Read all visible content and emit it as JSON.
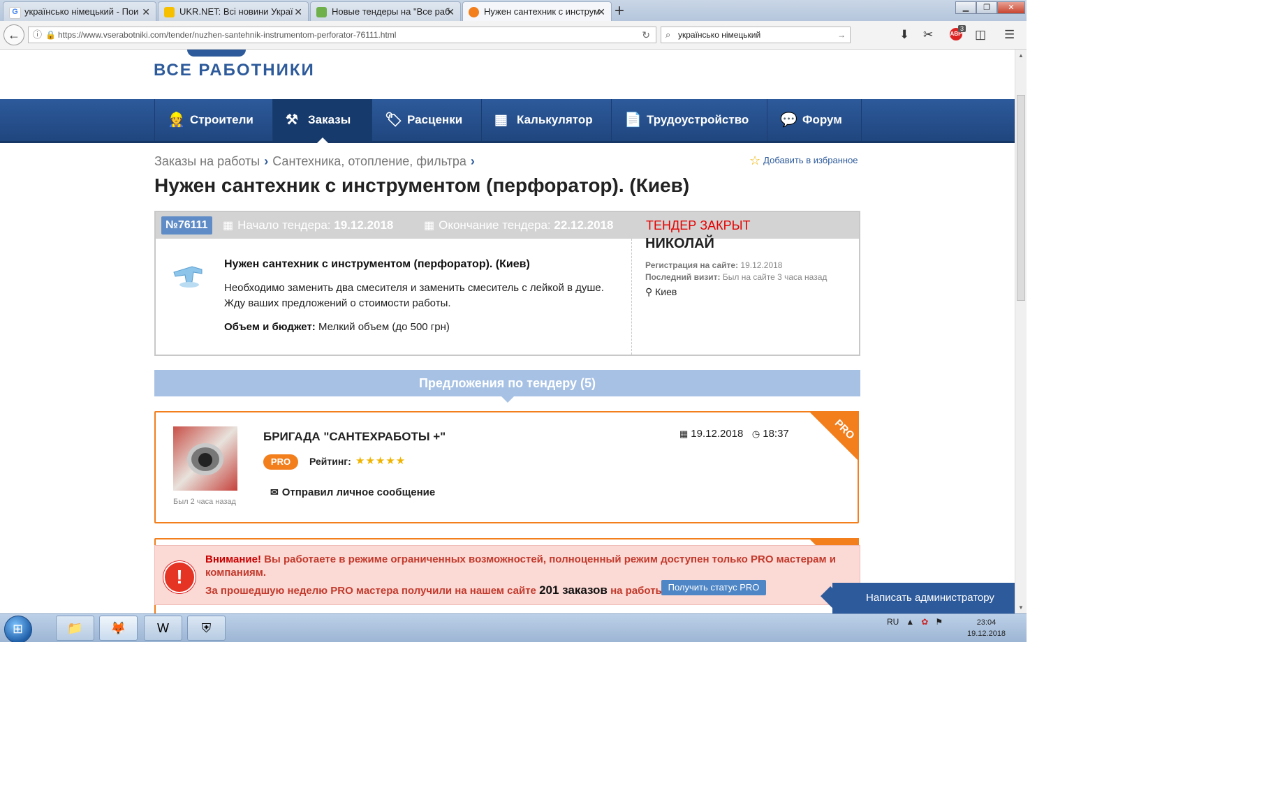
{
  "browser": {
    "tabs": [
      {
        "title": "українсько німецький - Пои",
        "favicon_color": "#4285f4"
      },
      {
        "title": "UKR.NET: Всі новини Украї",
        "favicon_color": "#f6c000"
      },
      {
        "title": "Новые тендеры на \"Все раб",
        "favicon_color": "#6fb04a"
      },
      {
        "title": "Нужен сантехник с инструм",
        "favicon_color": "#f27e1c"
      }
    ],
    "url": "https://www.vserabotniki.com/tender/nuzhen-santehnik-instrumentom-perforator-76111.html",
    "search_value": "українсько німецький",
    "adblock_count": "3"
  },
  "site": {
    "logo": "ВСЕ РАБОТНИКИ",
    "menu": [
      {
        "label": "Строители",
        "icon": "person-icon",
        "glyph": "👷"
      },
      {
        "label": "Заказы",
        "icon": "gavel-icon",
        "glyph": "⚒"
      },
      {
        "label": "Расценки",
        "icon": "tag-icon",
        "glyph": "🏷"
      },
      {
        "label": "Калькулятор",
        "icon": "calculator-icon",
        "glyph": "▦"
      },
      {
        "label": "Трудоустройство",
        "icon": "document-icon",
        "glyph": "📄"
      },
      {
        "label": "Форум",
        "icon": "chat-icon",
        "glyph": "💬"
      }
    ],
    "active_menu_index": 1
  },
  "breadcrumbs": [
    "Заказы на работы",
    "Сантехника, отопление, фильтра"
  ],
  "favorite_label": "Добавить в избранное",
  "page_title": "Нужен сантехник с инструментом (перфоратор). (Киев)",
  "tender": {
    "number": "№76111",
    "start_label": "Начало тендера:",
    "start_date": "19.12.2018",
    "end_label": "Окончание тендера:",
    "end_date": "22.12.2018",
    "status": "ТЕНДЕР ЗАКРЫТ",
    "title": "Нужен сантехник с инструментом (перфоратор). (Киев)",
    "desc_line1": "Необходимо заменить два смесителя и заменить смеситель с лейкой в душе.",
    "desc_line2": "Жду ваших предложений о стоимости работы.",
    "volume_label": "Объем и бюджет:",
    "volume_value": "Мелкий объем (до 500 грн)"
  },
  "customer": {
    "name": "НИКОЛАЙ",
    "reg_label": "Регистрация на сайте:",
    "reg_value": "19.12.2018",
    "visit_label": "Последний визит:",
    "visit_value": "Был на сайте 3 часа назад",
    "city": "Киев"
  },
  "offers": {
    "header": "Предложения по тендеру (5)",
    "items": [
      {
        "name": "БРИГАДА \"САНТЕХРАБОТЫ +\"",
        "badge": "PRO",
        "corner": "PRO",
        "rating_label": "Рейтинг:",
        "rating": 5,
        "stars": "★★★★★",
        "message": "Отправил личное сообщение",
        "date": "19.12.2018",
        "time": "18:37",
        "last_seen": "Был 2 часа назад"
      }
    ]
  },
  "warning": {
    "title": "Внимание!",
    "text": "Вы работаете в режиме ограниченных возможностей, полноценный режим доступен только PRO мастерам и компаниям.",
    "line2_pre": "За прошедшую неделю PRO мастера получили на нашем сайте",
    "line2_count": "201 заказов",
    "line2_post": "на работы.",
    "button": "Получить статус PRO"
  },
  "admin_label": "Написать администратору",
  "taskbar": {
    "lang": "RU",
    "time": "23:04",
    "date": "19.12.2018"
  }
}
